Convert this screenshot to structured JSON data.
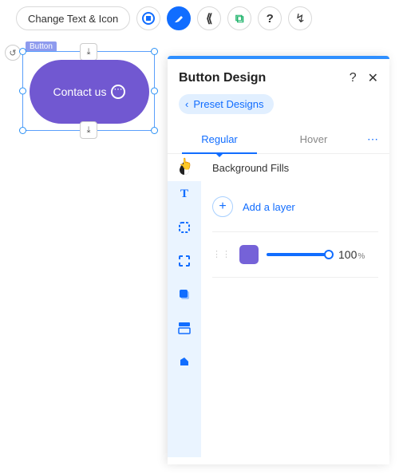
{
  "toolbar": {
    "change_text_icon": "Change Text & Icon",
    "icons": [
      "layout",
      "design",
      "animation",
      "link",
      "help",
      "stretch"
    ]
  },
  "canvas": {
    "selection_label": "Button",
    "button_text": "Contact us"
  },
  "panel": {
    "title": "Button Design",
    "preset_label": "Preset Designs",
    "tabs": {
      "regular": "Regular",
      "hover": "Hover"
    },
    "section_title": "Background Fills",
    "add_layer_label": "Add a layer",
    "layer": {
      "opacity_value": "100",
      "opacity_unit": "%",
      "swatch_color": "#7562d8"
    },
    "side_icons": [
      "fill",
      "text",
      "border",
      "corners",
      "shadow",
      "padding",
      "shape"
    ]
  }
}
